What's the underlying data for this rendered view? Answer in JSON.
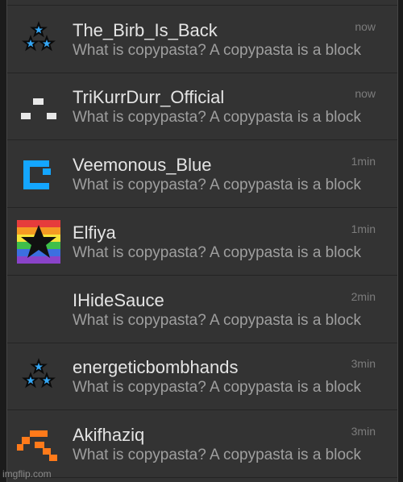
{
  "messages": [
    {
      "username": "The_Birb_Is_Back",
      "preview": "What is copypasta? A copypasta is a block",
      "time": "now",
      "avatar_icon": "blue-star-triangle-icon"
    },
    {
      "username": "TriKurrDurr_Official",
      "preview": "What is copypasta? A copypasta is a block",
      "time": "now",
      "avatar_icon": "white-pixel-face-icon"
    },
    {
      "username": "Veemonous_Blue",
      "preview": "What is copypasta? A copypasta is a block",
      "time": "1min",
      "avatar_icon": "blue-pixel-logo-icon"
    },
    {
      "username": "Elfiya",
      "preview": "What is copypasta? A copypasta is a block",
      "time": "1min",
      "avatar_icon": "rainbow-star-icon"
    },
    {
      "username": "IHideSauce",
      "preview": "What is copypasta? A copypasta is a block",
      "time": "2min",
      "avatar_icon": ""
    },
    {
      "username": "energeticbombhands",
      "preview": "What is copypasta? A copypasta is a block",
      "time": "3min",
      "avatar_icon": "blue-star-triangle-icon"
    },
    {
      "username": "Akifhaziq",
      "preview": "What is copypasta? A copypasta is a block",
      "time": "3min",
      "avatar_icon": "orange-pixel-icon"
    }
  ],
  "watermark": "imgflip.com",
  "colors": {
    "panel_background": "#333333",
    "username_text": "#e4e4e4",
    "preview_text": "#9f9f9f",
    "time_text": "#7c7c7c",
    "star_blue": "#35a7f5",
    "logo_blue": "#14a6ff",
    "orange": "#ff7a1a"
  }
}
